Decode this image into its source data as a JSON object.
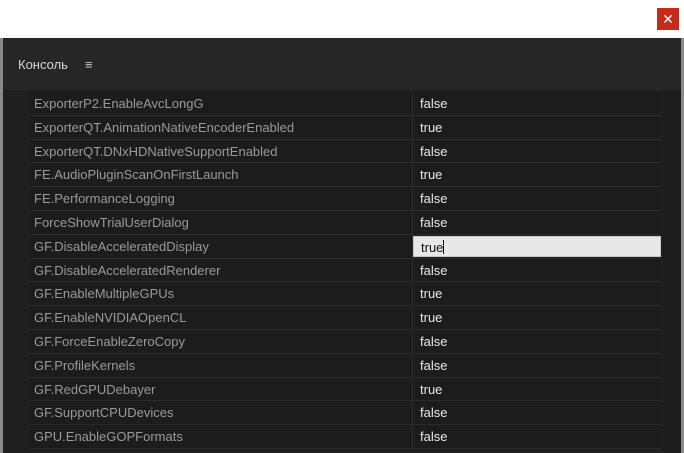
{
  "window": {
    "close_glyph": "✕"
  },
  "panel": {
    "title": "Консоль",
    "menu_glyph": "≡"
  },
  "rows": [
    {
      "name": "ExporterP2.EnableAvcLongG",
      "value": "false"
    },
    {
      "name": "ExporterQT.AnimationNativeEncoderEnabled",
      "value": "true"
    },
    {
      "name": "ExporterQT.DNxHDNativeSupportEnabled",
      "value": "false"
    },
    {
      "name": "FE.AudioPluginScanOnFirstLaunch",
      "value": "true"
    },
    {
      "name": "FE.PerformanceLogging",
      "value": "false"
    },
    {
      "name": "ForceShowTrialUserDialog",
      "value": "false"
    },
    {
      "name": "GF.DisableAcceleratedDisplay",
      "value": "true",
      "editing": true
    },
    {
      "name": "GF.DisableAcceleratedRenderer",
      "value": "false"
    },
    {
      "name": "GF.EnableMultipleGPUs",
      "value": "true"
    },
    {
      "name": "GF.EnableNVIDIAOpenCL",
      "value": "true"
    },
    {
      "name": "GF.ForceEnableZeroCopy",
      "value": "false"
    },
    {
      "name": "GF.ProfileKernels",
      "value": "false"
    },
    {
      "name": "GF.RedGPUDebayer",
      "value": "true"
    },
    {
      "name": "GF.SupportCPUDevices",
      "value": "false"
    },
    {
      "name": "GPU.EnableGOPFormats",
      "value": "false"
    }
  ]
}
